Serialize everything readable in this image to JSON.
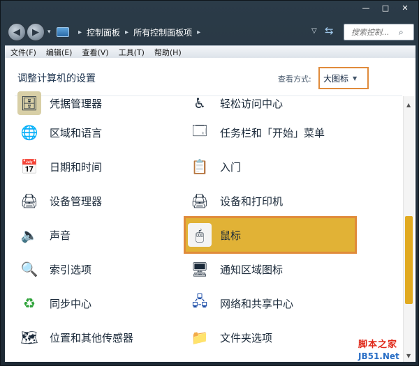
{
  "window": {
    "caption": {
      "minimize": "—",
      "maximize": "□",
      "close": "✕"
    },
    "nav": {
      "back_glyph": "◀",
      "forward_glyph": "▶",
      "dropdown_glyph": "▾"
    },
    "breadcrumb": [
      "控制面板",
      "所有控制面板项"
    ],
    "breadcrumb_sep": "▸",
    "search_placeholder": "搜索控制...",
    "search_icon": "search-icon"
  },
  "menu": [
    "文件(F)",
    "编辑(E)",
    "查看(V)",
    "工具(T)",
    "帮助(H)"
  ],
  "content": {
    "title": "调整计算机的设置",
    "view_label": "查看方式:",
    "view_value": "大图标",
    "left_items": [
      {
        "label": "凭据管理器",
        "icon": "credential-manager-icon"
      },
      {
        "label": "区域和语言",
        "icon": "region-language-icon"
      },
      {
        "label": "日期和时间",
        "icon": "date-time-icon"
      },
      {
        "label": "设备管理器",
        "icon": "device-manager-icon"
      },
      {
        "label": "声音",
        "icon": "sound-icon"
      },
      {
        "label": "索引选项",
        "icon": "indexing-options-icon"
      },
      {
        "label": "同步中心",
        "icon": "sync-center-icon"
      },
      {
        "label": "位置和其他传感器",
        "icon": "location-sensors-icon"
      }
    ],
    "right_items": [
      {
        "label": "轻松访问中心",
        "icon": "ease-of-access-icon"
      },
      {
        "label": "任务栏和「开始」菜单",
        "icon": "taskbar-start-menu-icon"
      },
      {
        "label": "入门",
        "icon": "getting-started-icon"
      },
      {
        "label": "设备和打印机",
        "icon": "devices-printers-icon"
      },
      {
        "label": "鼠标",
        "icon": "mouse-icon",
        "selected": true
      },
      {
        "label": "通知区域图标",
        "icon": "notification-area-icon"
      },
      {
        "label": "网络和共享中心",
        "icon": "network-sharing-icon"
      },
      {
        "label": "文件夹选项",
        "icon": "folder-options-icon"
      }
    ]
  },
  "watermark": {
    "line1": "脚本之家",
    "line2": "JB51.Net"
  },
  "colors": {
    "highlight": "#e1b236",
    "highlight_border": "#e08b3b",
    "title": "#1f3550"
  }
}
